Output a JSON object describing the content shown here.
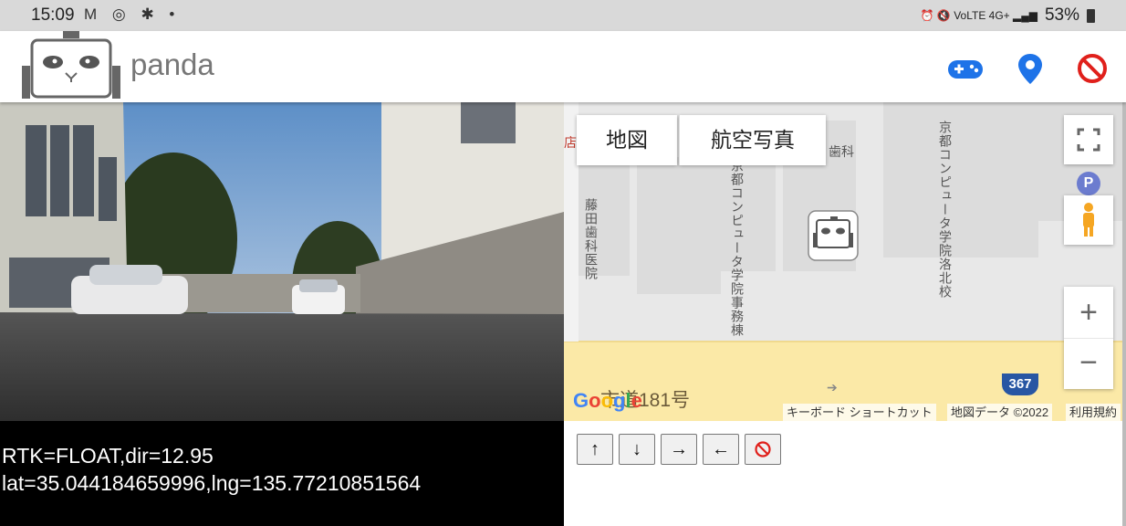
{
  "status_bar": {
    "time": "15:09",
    "notification_icons": [
      "gmail-icon",
      "messenger-icon",
      "slack-icon",
      "dot-icon"
    ],
    "notif_glyphs": "M ◎ ✱ •",
    "right_glyphs": "⏰ 🔇 VoLTE 4G+ ▂▄▆",
    "battery": "53%"
  },
  "app": {
    "name": "panda"
  },
  "header_icons": [
    "gamepad-icon",
    "location-pin-icon",
    "stop-icon"
  ],
  "map": {
    "type_buttons": [
      "地図",
      "航空写真"
    ],
    "labels": {
      "building_1": "藤田歯科医院",
      "building_2": "京都コンピュータ学院事務棟",
      "building_3": "京都コンピュータ学院洛北校",
      "dental": "歯科",
      "road": "市道181号",
      "route_number": "367",
      "edge_char": "店"
    },
    "parking": "P",
    "google_letters": [
      "G",
      "o",
      "o",
      "g",
      "l",
      "e"
    ],
    "attribution": {
      "shortcuts": "キーボード ショートカット",
      "map_data": "地図データ ©2022",
      "terms": "利用規約"
    },
    "zoom_in": "+",
    "zoom_out": "−",
    "colors": {
      "road": "#fbe9a7",
      "building": "#dcdcdc",
      "block": "#e8e8e8"
    }
  },
  "telemetry": {
    "line1": "RTK=FLOAT,dir=12.95",
    "line2": "lat=35.044184659996,lng=135.77210851564"
  },
  "controls": {
    "up": "↑",
    "down": "↓",
    "right": "→",
    "left": "←",
    "stop_icon": "stop-icon"
  },
  "colors": {
    "accent_blue": "#1e73e8",
    "stop_red": "#e0201b"
  }
}
